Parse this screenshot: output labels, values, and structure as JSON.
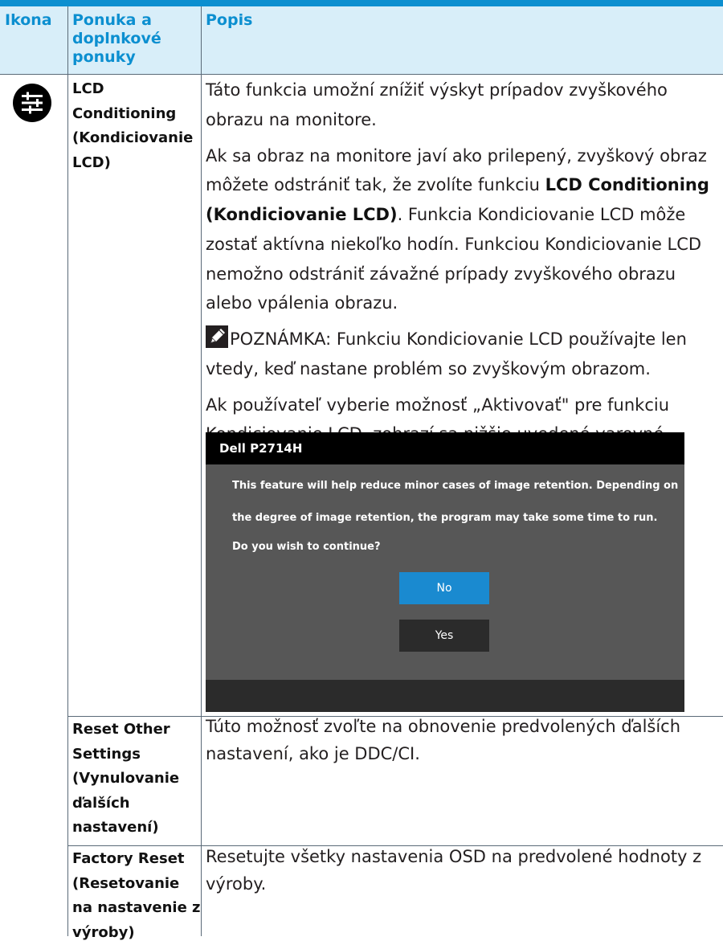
{
  "header": {
    "col_icon": "Ikona",
    "col_menu_lines": [
      "Ponuka a",
      "doplnkové",
      "ponuky"
    ],
    "col_desc": "Popis"
  },
  "icons": {
    "row1": "settings-sliders-icon",
    "note": "pencil-note-icon"
  },
  "colors": {
    "accent": "#0c8fd0",
    "header_bg": "#d8eef9",
    "dialog_bg": "#575757",
    "no_button": "#1a8ad0"
  },
  "rows": [
    {
      "menu_lines": [
        "LCD",
        "Conditioning",
        "(Kondiciovanie",
        "LCD)"
      ],
      "p1": "Táto funkcia umožní znížiť výskyt prípadov zvyškového obrazu na monitore.",
      "p2_before": "Ak sa obraz na monitore javí ako prilepený, zvyškový obraz môžete odstrániť tak, že zvolíte funkciu ",
      "p2_bold": "LCD Conditioning (Kondiciovanie LCD)",
      "p2_after": ". Funkcia Kondiciovanie LCD môže zostať aktívna niekoľko hodín.  Funkciou Kondiciovanie LCD nemožno odstrániť závažné prípady zvyškového obrazu alebo vpálenia obrazu.",
      "note_label": "POZNÁMKA",
      "note_text": ": Funkciu Kondiciovanie LCD používajte len vtedy, keď nastane problém so zvyškovým obrazom.",
      "p4": "Ak používateľ vyberie možnosť „Aktivovať\" pre funkciu Kondiciovanie LCD, zobrazí sa nižšie uvedené varovné hlásenie."
    },
    {
      "menu_lines": [
        "Reset Other",
        "Settings",
        "(Vynulovanie",
        "ďalších",
        "nastavení)"
      ],
      "desc": "Túto možnosť zvoľte na obnovenie predvolených ďalších nastavení, ako je DDC/CI."
    },
    {
      "menu_lines": [
        "Factory Reset",
        "(Resetovanie",
        "na nastavenie z",
        "výroby)"
      ],
      "desc": "Resetujte všetky nastavenia OSD na predvolené hodnoty z výroby."
    }
  ],
  "dialog": {
    "title": "Dell P2714H",
    "line1": "This feature will help reduce minor cases of image retention. Depending on",
    "line2": "the degree of image retention, the program may take some time to run.",
    "line3": "Do you wish to continue?",
    "no_label": "No",
    "yes_label": "Yes"
  }
}
